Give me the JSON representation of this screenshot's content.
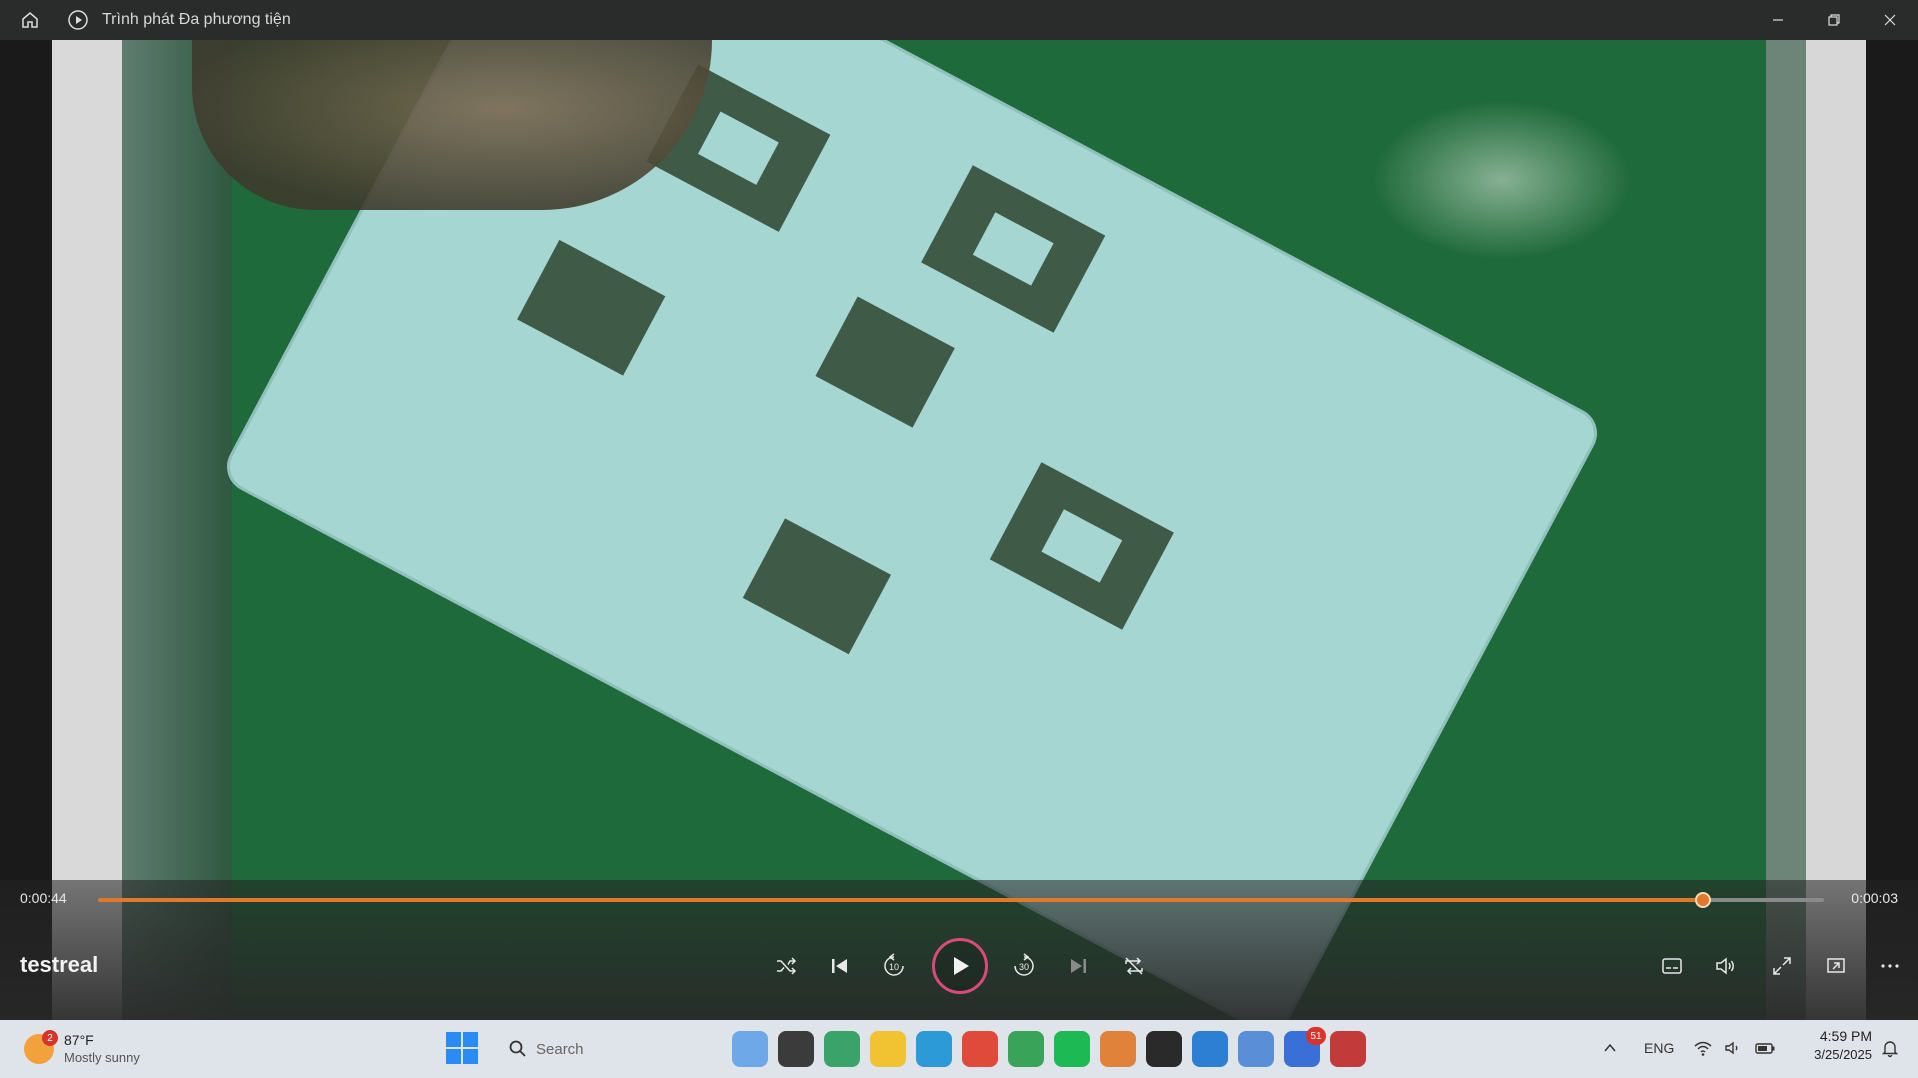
{
  "window": {
    "title": "Trình phát Đa phương tiện"
  },
  "player": {
    "current_time": "0:00:44",
    "total_time": "0:00:03",
    "progress": 0.93,
    "media_title": "testreal",
    "accent_color": "#e07a2a"
  },
  "controls": {
    "shuffle_icon": "shuffle-icon",
    "previous_icon": "previous-icon",
    "rewind_label": "10",
    "forward_label": "30",
    "play_icon": "play-icon",
    "next_icon": "next-icon",
    "repeat_icon": "repeat-icon",
    "right": [
      "captions-icon",
      "volume-icon",
      "fullscreen-icon",
      "miniplayer-icon",
      "more-icon"
    ]
  },
  "taskbar": {
    "weather_temp": "87°F",
    "weather_condition": "Mostly sunny",
    "weather_badge": "2",
    "search_placeholder": "Search",
    "apps": [
      {
        "name": "widgets-app",
        "color": "#6fa8e8"
      },
      {
        "name": "task-view",
        "color": "#3b3b3b"
      },
      {
        "name": "photos-app",
        "color": "#3aa36a"
      },
      {
        "name": "file-explorer",
        "color": "#f1c232"
      },
      {
        "name": "edge-browser",
        "color": "#2b9ad6"
      },
      {
        "name": "chrome-browser",
        "color": "#e04a3a"
      },
      {
        "name": "chrome-browser-2",
        "color": "#3aa35a"
      },
      {
        "name": "spotify-app",
        "color": "#1db954"
      },
      {
        "name": "sublime-app",
        "color": "#e0823a"
      },
      {
        "name": "terminal-app",
        "color": "#2a2a2a"
      },
      {
        "name": "vscode-app",
        "color": "#2d7fd3"
      },
      {
        "name": "network-app",
        "color": "#5a8fd8"
      },
      {
        "name": "messenger-app",
        "color": "#3b6fd8",
        "badge": "51"
      },
      {
        "name": "media-player-app",
        "color": "#c23a3a"
      }
    ],
    "language": "ENG",
    "time": "4:59 PM",
    "date": "3/25/2025"
  }
}
